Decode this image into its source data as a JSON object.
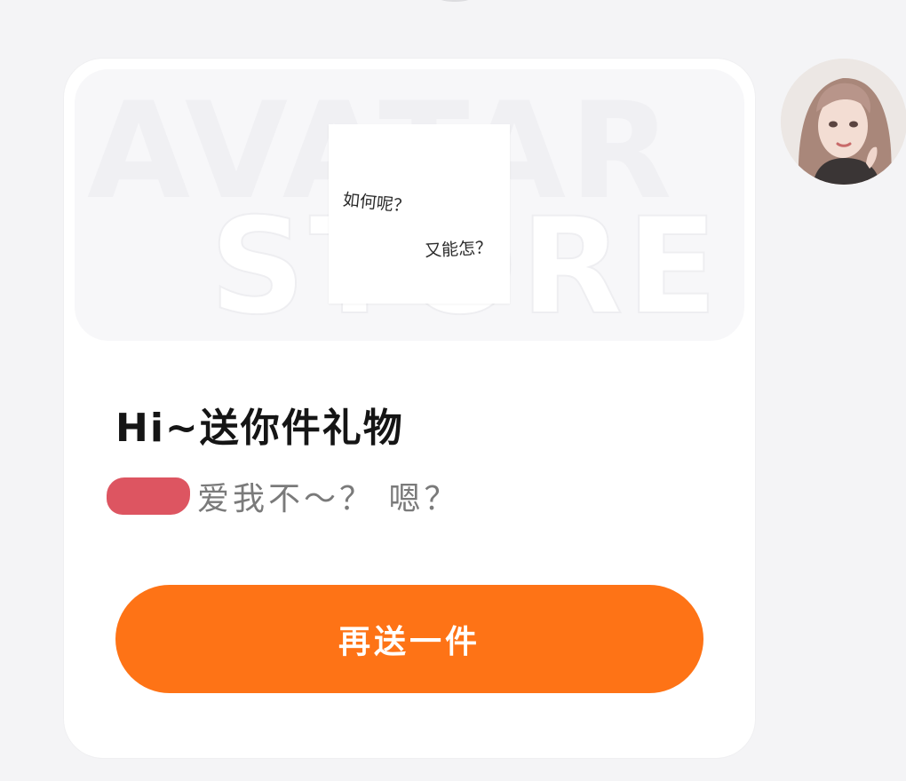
{
  "banner": {
    "watermark_line1": "AVATAR",
    "watermark_line2": "STORE",
    "note_line1": "如何呢？",
    "note_line2": "又能怎？"
  },
  "gift": {
    "title": "Hi~送你件礼物",
    "message": "爱我不～？ 嗯？",
    "button_label": "再送一件"
  },
  "colors": {
    "accent": "#fe7316",
    "redaction": "#dd5561",
    "background": "#f4f4f6",
    "card": "#ffffff"
  }
}
